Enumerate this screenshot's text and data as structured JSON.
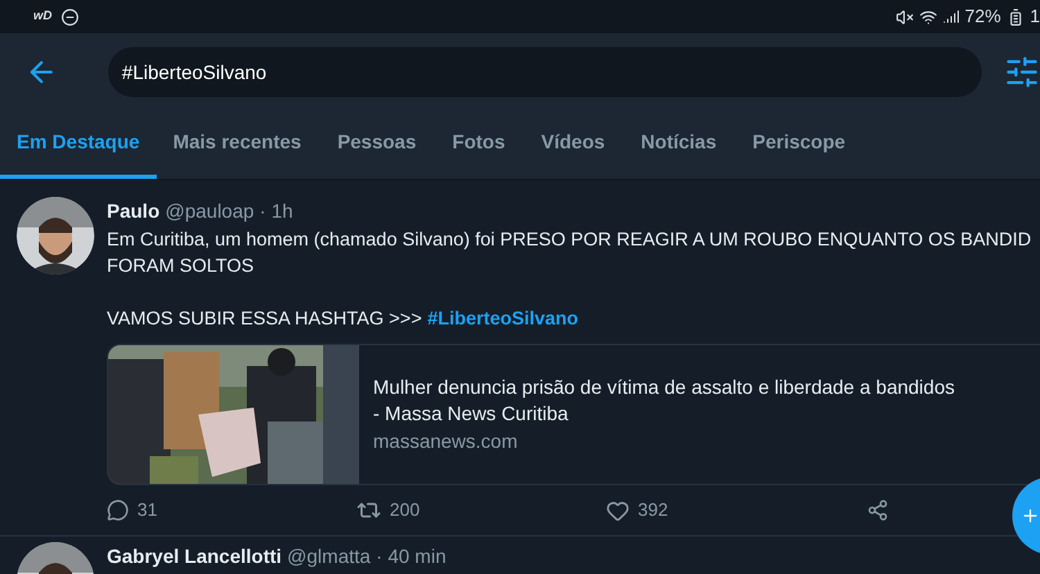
{
  "status_bar": {
    "left_logo": "wD",
    "battery": "72%",
    "time_partial": "1"
  },
  "search": {
    "value": "#LiberteoSilvano"
  },
  "tabs": [
    {
      "label": "Em Destaque",
      "selected": true
    },
    {
      "label": "Mais recentes",
      "selected": false
    },
    {
      "label": "Pessoas",
      "selected": false
    },
    {
      "label": "Fotos",
      "selected": false
    },
    {
      "label": "Vídeos",
      "selected": false
    },
    {
      "label": "Notícias",
      "selected": false
    },
    {
      "label": "Periscope",
      "selected": false
    }
  ],
  "tweets": [
    {
      "name": "Paulo",
      "handle": "@pauloap",
      "time": "· 1h",
      "body_lines": [
        "Em Curitiba, um homem (chamado Silvano) foi PRESO POR REAGIR A UM ROUBO ENQUANTO OS BANDID",
        "FORAM SOLTOS"
      ],
      "cta": "VAMOS SUBIR ESSA HASHTAG >>>",
      "hashtag": "#LiberteoSilvano",
      "card": {
        "kind": "picture",
        "title_lines": [
          "Mulher denuncia prisão de vítima de assalto e liberdade a bandidos",
          "- Massa News Curitiba"
        ],
        "domain": "massanews.com"
      },
      "replies": "31",
      "retweets": "200",
      "likes": "392"
    },
    {
      "name": "Gabryel Lancellotti",
      "handle": "@glmatta",
      "time": "· 40 min"
    }
  ]
}
